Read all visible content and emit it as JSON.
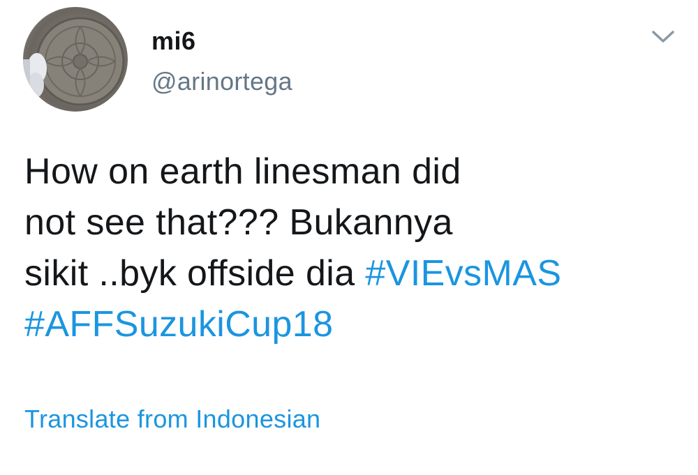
{
  "user": {
    "display_name": "mi6",
    "handle": "@arinortega",
    "avatar_icon": "manhole-cover-avatar"
  },
  "menu": {
    "icon": "chevron-down-icon"
  },
  "tweet": {
    "line1": "How on earth linesman did",
    "line2": "not see that??? Bukannya",
    "line3_text": "sikit ..byk offside dia ",
    "hashtag1": "#VIEvsMAS",
    "hashtag2": "#AFFSuzukiCup18"
  },
  "translate_label": "Translate from Indonesian",
  "colors": {
    "link": "#1b95e0",
    "text": "#14171a",
    "secondary": "#657786"
  }
}
